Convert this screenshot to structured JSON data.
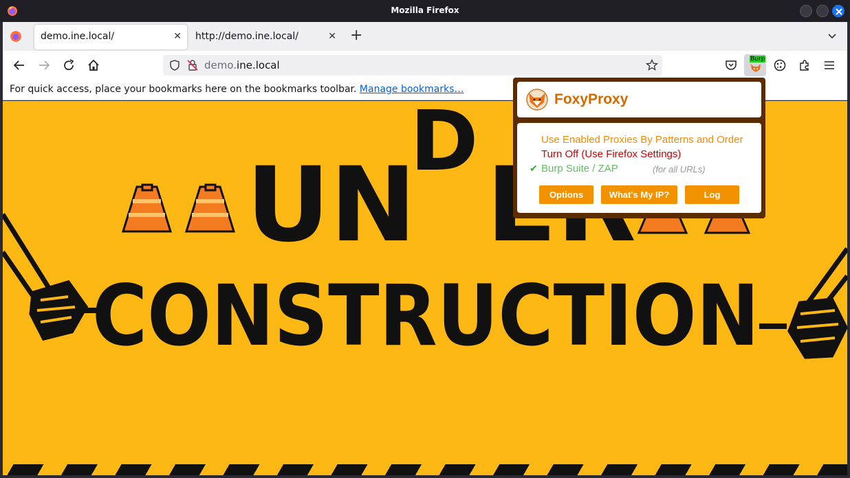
{
  "window": {
    "title": "Mozilla Firefox"
  },
  "tabs": [
    {
      "label": "demo.ine.local/",
      "active": true
    },
    {
      "label": "http://demo.ine.local/",
      "active": false
    }
  ],
  "navbar": {
    "url_domain_dim": "demo.",
    "url_domain_main": "ine.local",
    "extension_badge": "Burp"
  },
  "bookmarks": {
    "message": "For quick access, place your bookmarks here on the bookmarks toolbar.",
    "manage_link": "Manage bookmarks…"
  },
  "page": {
    "line1": "UN",
    "line1_d": "D",
    "line1_tail": "ER",
    "line2": "CONSTRUCTION",
    "colors": {
      "background": "#fdb813",
      "text": "#111111",
      "cone": "#f47b20"
    }
  },
  "foxyproxy": {
    "brand": "FoxyProxy",
    "options": [
      "Use Enabled Proxies By Patterns and Order",
      "Turn Off (Use Firefox Settings)",
      "Burp Suite / ZAP"
    ],
    "selected_check": "✔",
    "note": "(for all URLs)",
    "buttons": [
      "Options",
      "What's My IP?",
      "Log"
    ],
    "colors": {
      "frame": "#5c2b00",
      "brand": "#d26a00",
      "button": "#f39200"
    }
  }
}
